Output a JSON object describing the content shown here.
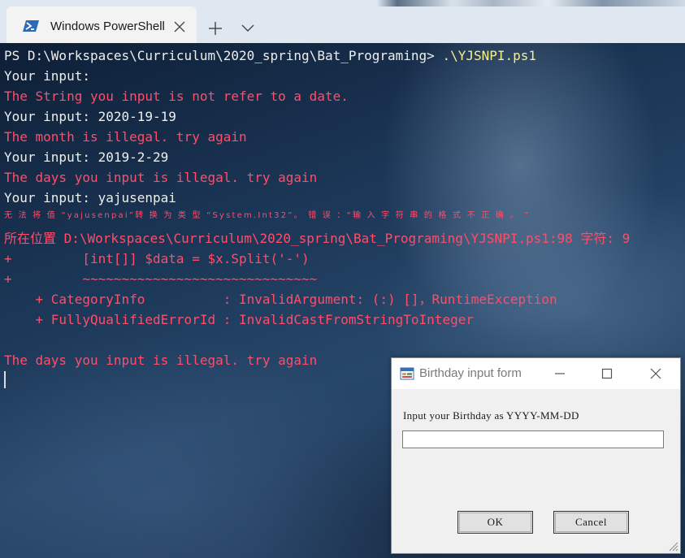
{
  "window": {
    "tab_title": "Windows PowerShell",
    "tab_icon": "powershell-icon",
    "new_tab_icon": "plus-icon",
    "dropdown_icon": "chevron-down-icon",
    "close_icon": "close-icon"
  },
  "terminal": {
    "prompt": "PS D:\\Workspaces\\Curriculum\\2020_spring\\Bat_Programing>",
    "command": ".\\YJSNPI.ps1",
    "lines": [
      "Your input:",
      "The String you input is not refer to a date.",
      "Your input: 2020-19-19",
      "The month is illegal. try again",
      "Your input: 2019-2-29",
      "The days you input is illegal. try again",
      "Your input: yajusenpai",
      "无 法 将 值 “yajusenpai”转 换 为 类 型 “System.Int32”。 错 误 ：“输 入 字 符 串 的 格 式 不 正 确 。 ”",
      "所在位置 D:\\Workspaces\\Curriculum\\2020_spring\\Bat_Programing\\YJSNPI.ps1:98 字符: 9",
      "+         [int[]] $data = $x.Split('-')",
      "+         ~~~~~~~~~~~~~~~~~~~~~~~~~~~~~~",
      "    + CategoryInfo          : InvalidArgument: (:) []，RuntimeException",
      "    + FullyQualifiedErrorId : InvalidCastFromStringToInteger",
      "The days you input is illegal. try again"
    ]
  },
  "dialog": {
    "title": "Birthday input form",
    "label": "Input your Birthday as YYYY-MM-DD",
    "input_value": "",
    "ok_label": "OK",
    "cancel_label": "Cancel",
    "icons": {
      "app": "form-icon",
      "minimize": "minimize-icon",
      "maximize": "maximize-icon",
      "close": "close-icon",
      "grip": "resize-grip-icon"
    }
  },
  "colors": {
    "terminal_text": "#eeeeee",
    "error_text": "#ff4d6a",
    "command_text": "#f4f08c"
  }
}
